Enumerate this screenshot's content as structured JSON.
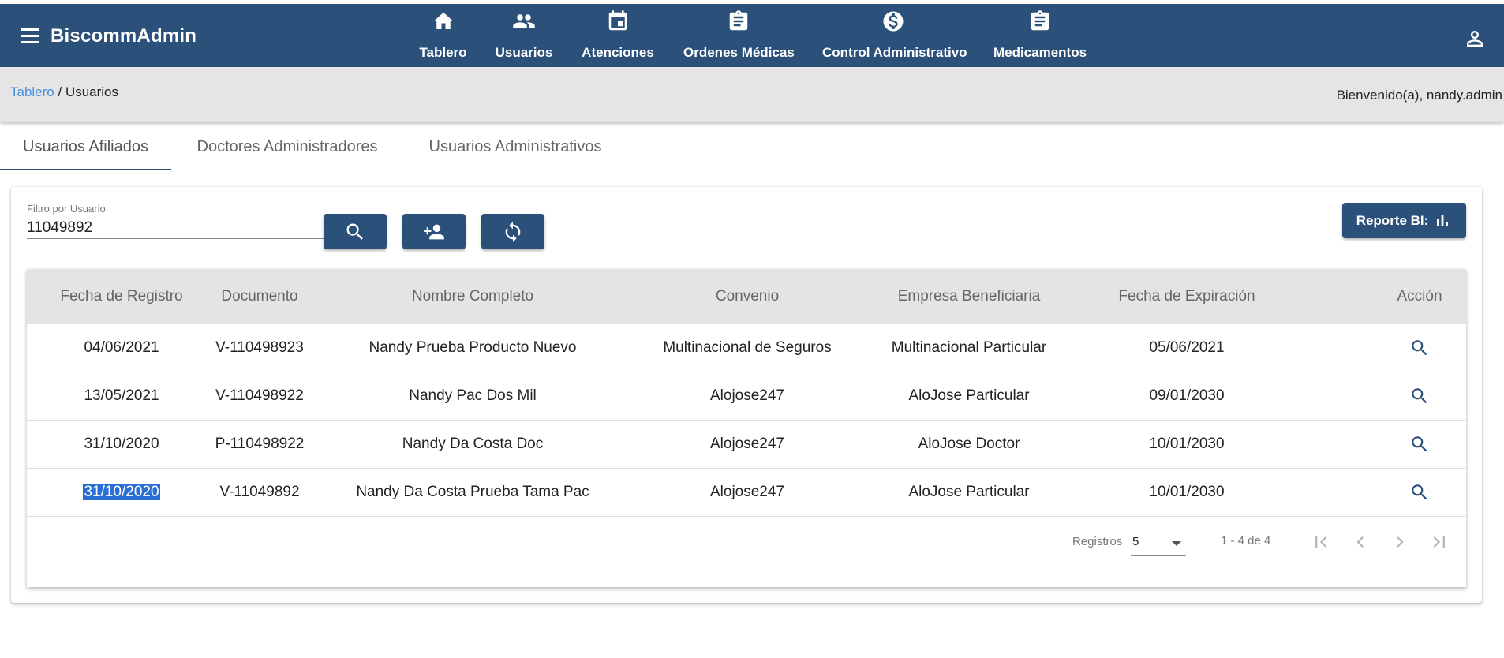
{
  "app": {
    "brand": "BiscommAdmin"
  },
  "nav": {
    "items": [
      {
        "label": "Tablero",
        "icon": "home-icon"
      },
      {
        "label": "Usuarios",
        "icon": "people-icon"
      },
      {
        "label": "Atenciones",
        "icon": "calendar-icon"
      },
      {
        "label": "Ordenes Médicas",
        "icon": "clipboard-icon"
      },
      {
        "label": "Control Administrativo",
        "icon": "dollar-circle-icon"
      },
      {
        "label": "Medicamentos",
        "icon": "clipboard-icon"
      }
    ]
  },
  "breadcrumb": {
    "link": "Tablero",
    "separator": " / ",
    "current": "Usuarios"
  },
  "welcome": "Bienvenido(a), nandy.admin",
  "tabs": [
    {
      "label": "Usuarios Afiliados",
      "active": true
    },
    {
      "label": "Doctores Administradores",
      "active": false
    },
    {
      "label": "Usuarios Administrativos",
      "active": false
    }
  ],
  "filter": {
    "label": "Filtro por Usuario",
    "value": "11049892"
  },
  "report_button": "Reporte BI:",
  "table": {
    "headers": [
      "Fecha de Registro",
      "Documento",
      "Nombre Completo",
      "Convenio",
      "Empresa Beneficiaria",
      "Fecha de Expiración",
      "Acción"
    ],
    "rows": [
      {
        "fecha": "04/06/2021",
        "documento": "V-110498923",
        "nombre": "Nandy Prueba Producto Nuevo",
        "convenio": "Multinacional de Seguros",
        "empresa": "Multinacional Particular",
        "expiracion": "05/06/2021"
      },
      {
        "fecha": "13/05/2021",
        "documento": "V-110498922",
        "nombre": "Nandy Pac Dos Mil",
        "convenio": "Alojose247",
        "empresa": "AloJose Particular",
        "expiracion": "09/01/2030"
      },
      {
        "fecha": "31/10/2020",
        "documento": "P-110498922",
        "nombre": "Nandy Da Costa Doc",
        "convenio": "Alojose247",
        "empresa": "AloJose Doctor",
        "expiracion": "10/01/2030"
      },
      {
        "fecha": "31/10/2020",
        "documento": "V-11049892",
        "nombre": "Nandy Da Costa Prueba Tama Pac",
        "convenio": "Alojose247",
        "empresa": "AloJose Particular",
        "expiracion": "10/01/2030"
      }
    ]
  },
  "pager": {
    "label": "Registros",
    "page_size": "5",
    "range": "1 - 4 de 4"
  },
  "colors": {
    "primary": "#2b5079",
    "link": "#4a8ee0",
    "selection": "#2a6fd6"
  }
}
